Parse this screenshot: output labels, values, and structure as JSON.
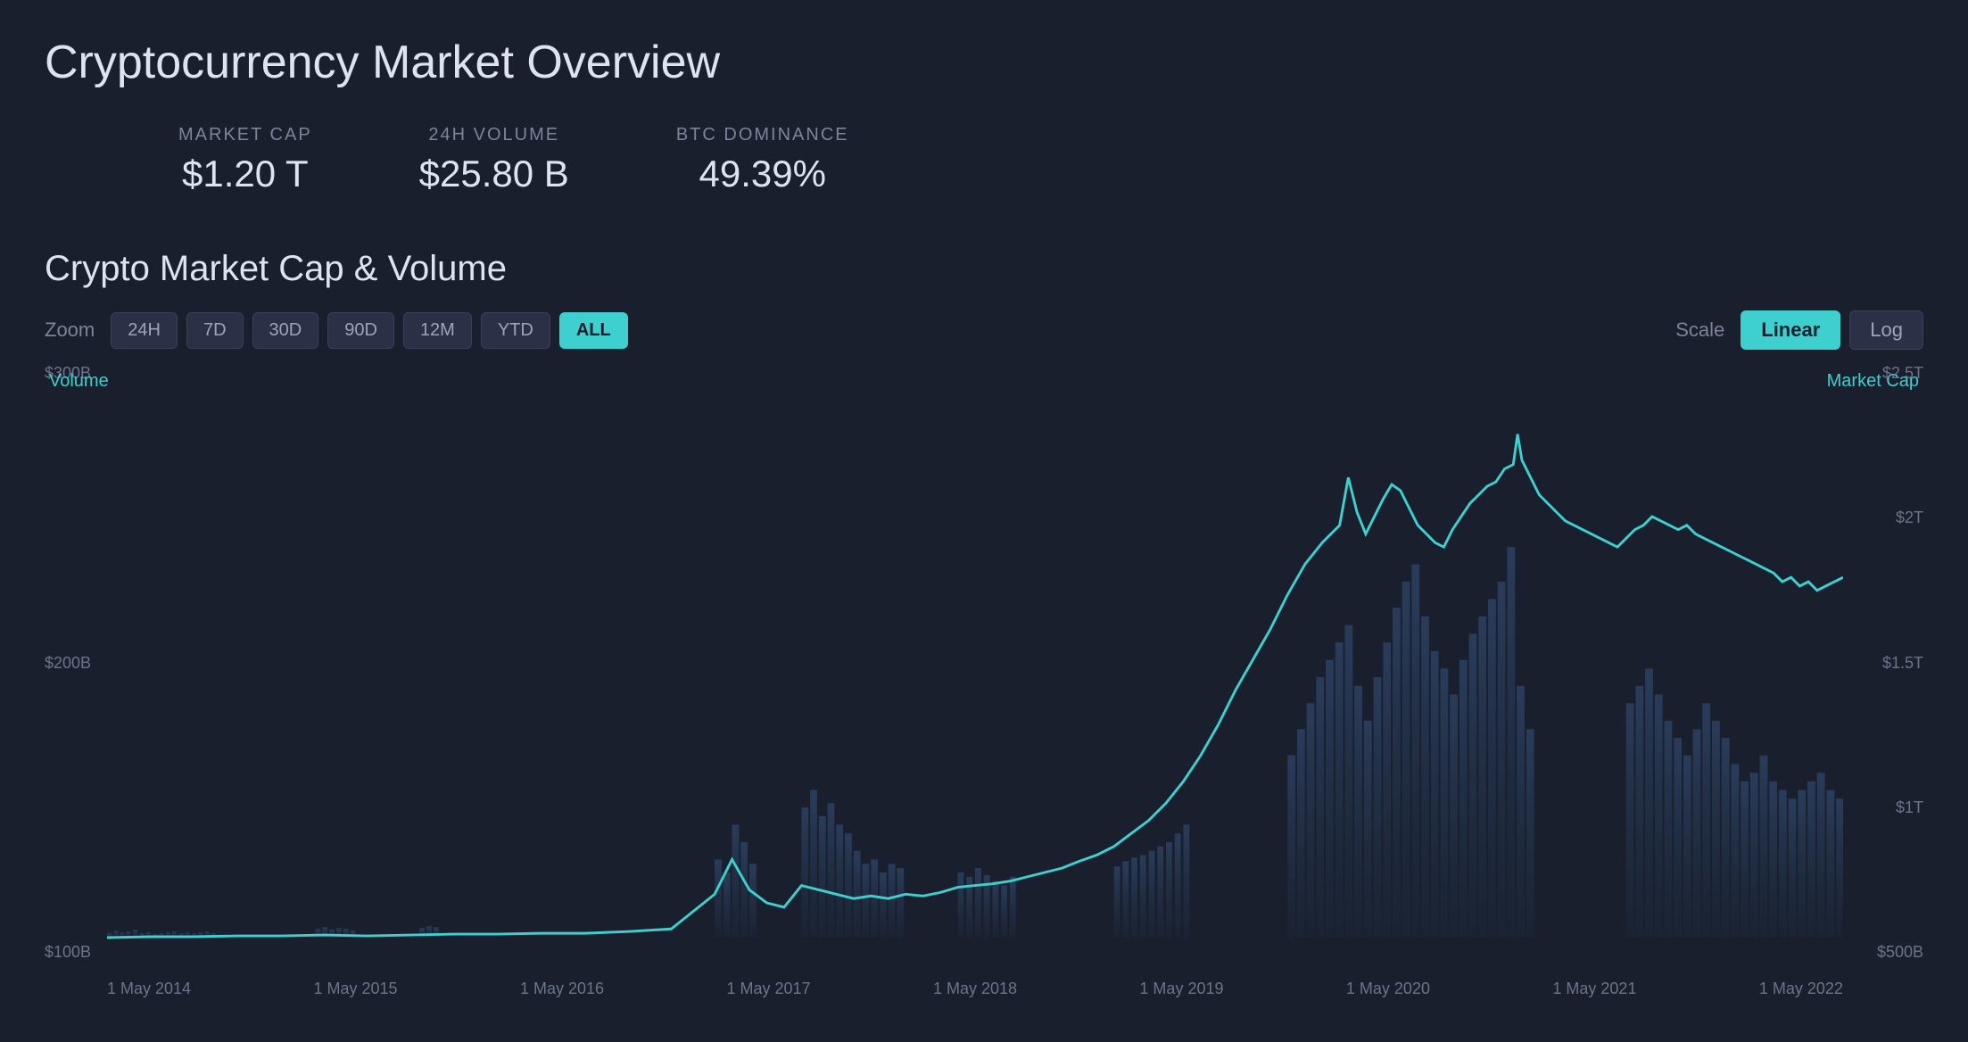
{
  "page": {
    "title": "Cryptocurrency Market Overview"
  },
  "stats": {
    "market_cap": {
      "label": "MARKET CAP",
      "value": "$1.20 T"
    },
    "volume": {
      "label": "24H VOLUME",
      "value": "$25.80 B"
    },
    "btc_dominance": {
      "label": "BTC DOMINANCE",
      "value": "49.39%"
    }
  },
  "chart": {
    "title": "Crypto Market Cap & Volume",
    "zoom_label": "Zoom",
    "scale_label": "Scale",
    "zoom_buttons": [
      "24H",
      "7D",
      "30D",
      "90D",
      "12M",
      "YTD",
      "ALL"
    ],
    "active_zoom": "ALL",
    "scale_buttons": [
      "Linear",
      "Log"
    ],
    "active_scale": "Linear",
    "y_axis_left": [
      "$300B",
      "$200B",
      "$100B"
    ],
    "y_axis_right": [
      "$2.5T",
      "$2T",
      "$1.5T",
      "$1T",
      "$500B"
    ],
    "label_left": "Volume",
    "label_right": "Market Cap",
    "x_axis": [
      "1 May 2014",
      "1 May 2015",
      "1 May 2016",
      "1 May 2017",
      "1 May 2018",
      "1 May 2019",
      "1 May 2020",
      "1 May 2021",
      "1 May 2022"
    ]
  },
  "colors": {
    "accent": "#3ecfcf",
    "background": "#1a1f2e",
    "bar": "#2a3a50",
    "line": "#3ecfcf"
  }
}
